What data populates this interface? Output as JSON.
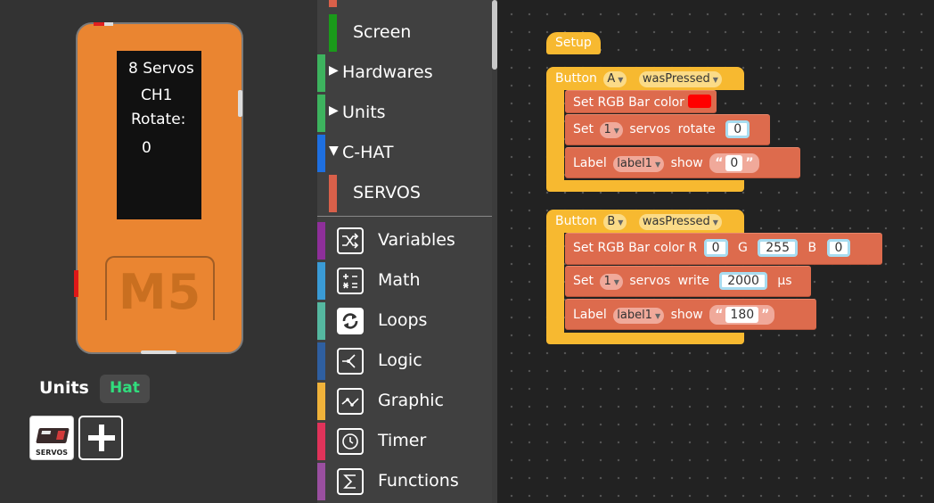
{
  "device": {
    "screen_lines": [
      "8 Servos",
      "CH1",
      "Rotate:",
      "0"
    ],
    "logo": "M5"
  },
  "tabs": {
    "units": "Units",
    "hat": "Hat"
  },
  "unit_thumbnail": {
    "caption": "SERVOS",
    "icon": "servos-hat-image"
  },
  "add_button_icon": "plus-icon",
  "categories": [
    {
      "label": "Screen",
      "color": "#1a9a1a"
    },
    {
      "label": "Hardwares",
      "color": "#3db35e",
      "arrow": "▶"
    },
    {
      "label": "Units",
      "color": "#3db35e",
      "arrow": "▶"
    },
    {
      "label": "C-HAT",
      "color": "#1e6fe0",
      "arrow": "▼"
    },
    {
      "label": "SERVOS",
      "color": "#d9604a"
    },
    {
      "label": "Variables",
      "color": "#8e2f9a",
      "icon": "shuffle-icon"
    },
    {
      "label": "Math",
      "color": "#3a9bd6",
      "icon": "calculator-icon"
    },
    {
      "label": "Loops",
      "color": "#55b8a0",
      "icon": "loop-arrows-icon"
    },
    {
      "label": "Logic",
      "color": "#2f5fa0",
      "icon": "branch-icon"
    },
    {
      "label": "Graphic",
      "color": "#f0b23a",
      "icon": "line-graph-icon"
    },
    {
      "label": "Timer",
      "color": "#e0335a",
      "icon": "clock-icon"
    },
    {
      "label": "Functions",
      "color": "#9a4fa0",
      "icon": "sigma-icon"
    }
  ],
  "workspace": {
    "setup": "Setup",
    "button_a": {
      "btn": "Button",
      "which": "A",
      "event": "wasPressed",
      "rgb_label": "Set RGB Bar color",
      "rgb_color": "#ff0000",
      "set_word": "Set",
      "servo_num": "1",
      "servos_word": "servos",
      "action": "rotate",
      "value": "0",
      "label_word": "Label",
      "label_name": "label1",
      "show_word": "show",
      "text": "0"
    },
    "button_b": {
      "btn": "Button",
      "which": "B",
      "event": "wasPressed",
      "rgb_label": "Set RGB Bar color R",
      "r": "0",
      "g_label": "G",
      "g": "255",
      "b_label": "B",
      "b": "0",
      "set_word": "Set",
      "servo_num": "1",
      "servos_word": "servos",
      "action": "write",
      "value": "2000",
      "unit": "μs",
      "label_word": "Label",
      "label_name": "label1",
      "show_word": "show",
      "text": "180"
    }
  }
}
